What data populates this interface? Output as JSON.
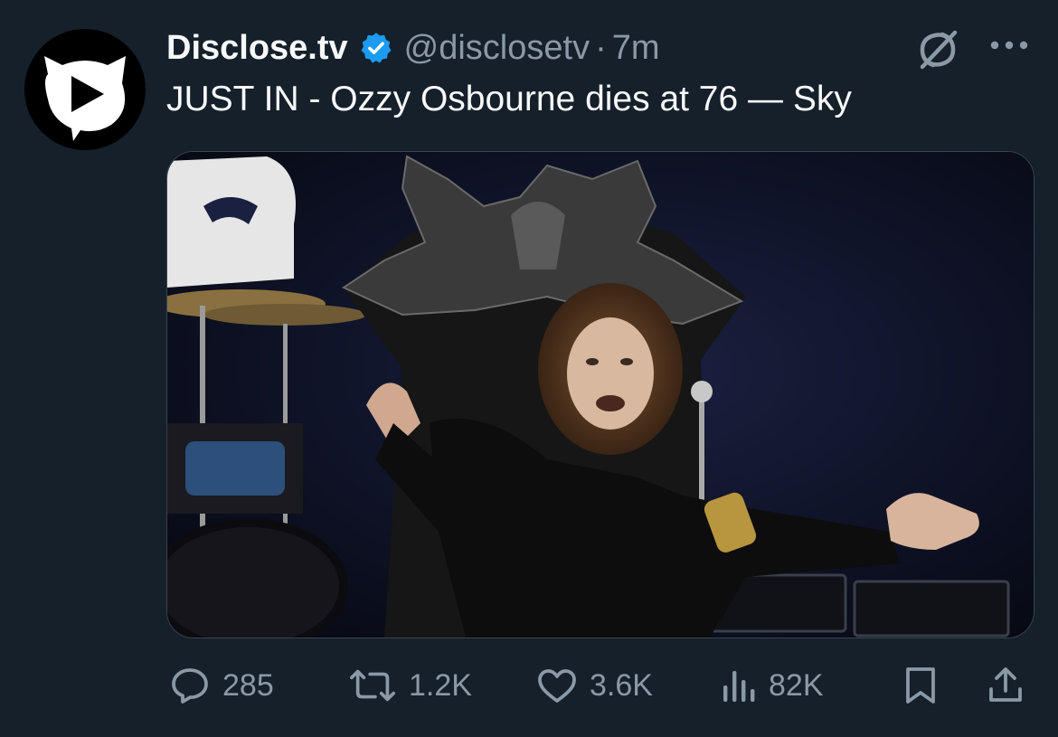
{
  "tweet": {
    "author_name": "Disclose.tv",
    "handle": "@disclosetv",
    "separator": "·",
    "time": "7m",
    "text": "JUST IN - Ozzy Osbourne dies at 76 — Sky",
    "verified": true
  },
  "icons": {
    "avatar": "disclose-tv-logo",
    "verified": "verified-badge-icon",
    "grok": "grok-icon",
    "more": "more-icon",
    "reply": "reply-icon",
    "retweet": "retweet-icon",
    "like": "like-icon",
    "views": "views-icon",
    "bookmark": "bookmark-icon",
    "share": "share-icon"
  },
  "stats": {
    "replies": "285",
    "reposts": "1.2K",
    "likes": "3.6K",
    "views": "82K"
  },
  "colors": {
    "background": "#15202b",
    "text": "#f7f9f9",
    "secondary": "#8b98a5",
    "verified": "#1d9bf0"
  }
}
